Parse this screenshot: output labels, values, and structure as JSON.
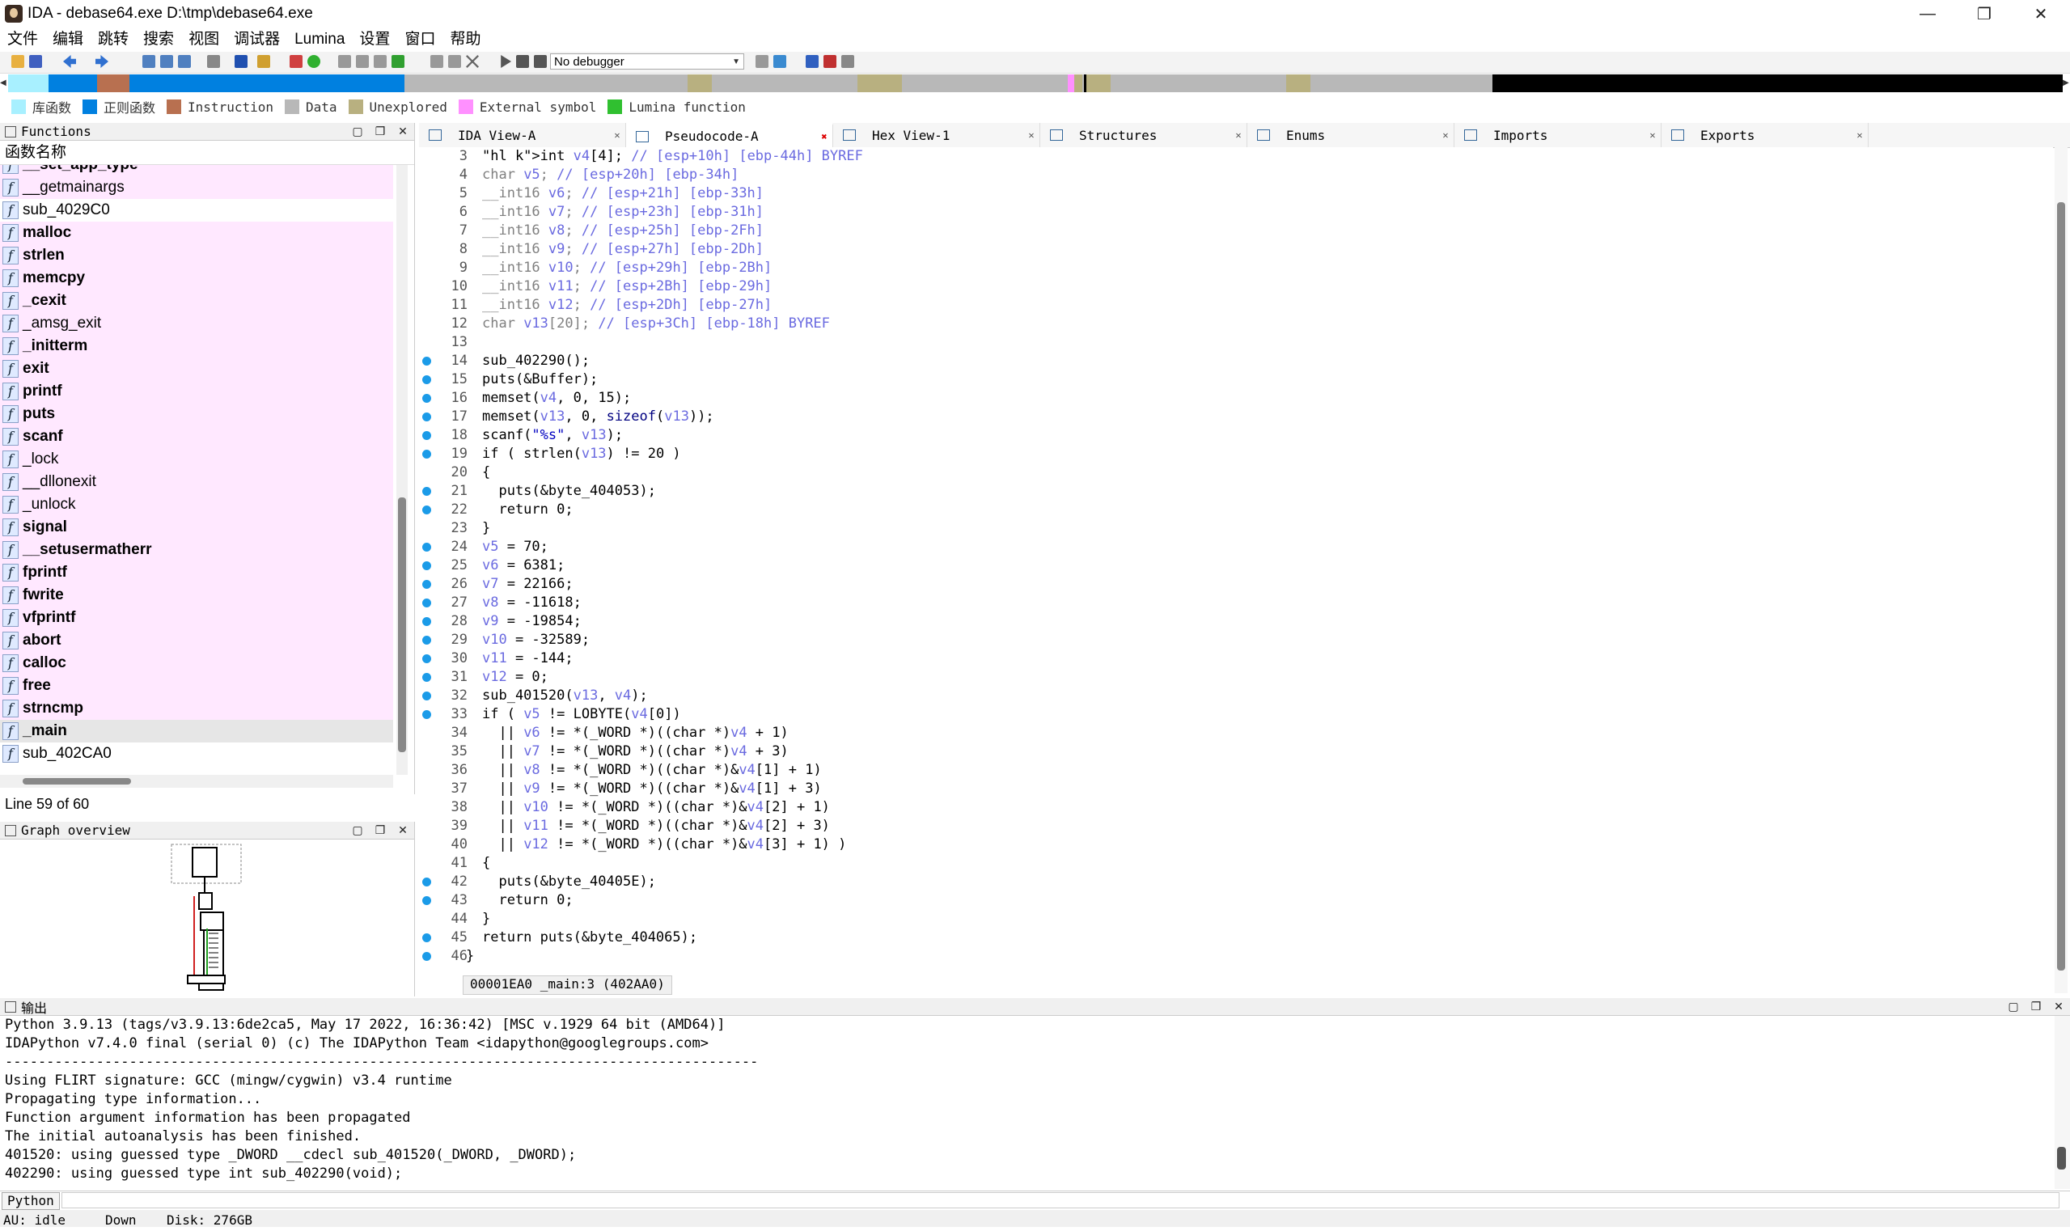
{
  "window": {
    "title": "IDA - debase64.exe D:\\tmp\\debase64.exe",
    "minimize": "—",
    "restore": "❐",
    "close": "✕"
  },
  "menu": [
    "文件",
    "编辑",
    "跳转",
    "搜索",
    "视图",
    "调试器",
    "Lumina",
    "设置",
    "窗口",
    "帮助"
  ],
  "toolbar": {
    "debugger_select": "No debugger"
  },
  "legend": [
    {
      "label": "库函数",
      "color": "#a8f0ff"
    },
    {
      "label": "正则函数",
      "color": "#0080e0"
    },
    {
      "label": "Instruction",
      "color": "#b87050"
    },
    {
      "label": "Data",
      "color": "#b8b8b8"
    },
    {
      "label": "Unexplored",
      "color": "#b8b080"
    },
    {
      "label": "External symbol",
      "color": "#ff90ff"
    },
    {
      "label": "Lumina function",
      "color": "#30c030"
    }
  ],
  "functions_panel": {
    "title": "Functions",
    "column_header": "函数名称",
    "status": "Line 59 of 60",
    "items": [
      {
        "name": "__set_app_type",
        "bold": true,
        "lib": true
      },
      {
        "name": "__getmainargs",
        "bold": false,
        "lib": true
      },
      {
        "name": "sub_4029C0",
        "bold": false,
        "lib": false
      },
      {
        "name": "malloc",
        "bold": true,
        "lib": true
      },
      {
        "name": "strlen",
        "bold": true,
        "lib": true
      },
      {
        "name": "memcpy",
        "bold": true,
        "lib": true
      },
      {
        "name": "_cexit",
        "bold": true,
        "lib": true
      },
      {
        "name": "_amsg_exit",
        "bold": false,
        "lib": true
      },
      {
        "name": "_initterm",
        "bold": true,
        "lib": true
      },
      {
        "name": "exit",
        "bold": true,
        "lib": true
      },
      {
        "name": "printf",
        "bold": true,
        "lib": true
      },
      {
        "name": "puts",
        "bold": true,
        "lib": true
      },
      {
        "name": "scanf",
        "bold": true,
        "lib": true
      },
      {
        "name": "_lock",
        "bold": false,
        "lib": true
      },
      {
        "name": "__dllonexit",
        "bold": false,
        "lib": true
      },
      {
        "name": "_unlock",
        "bold": false,
        "lib": true
      },
      {
        "name": "signal",
        "bold": true,
        "lib": true
      },
      {
        "name": "__setusermatherr",
        "bold": true,
        "lib": true
      },
      {
        "name": "fprintf",
        "bold": true,
        "lib": true
      },
      {
        "name": "fwrite",
        "bold": true,
        "lib": true
      },
      {
        "name": "vfprintf",
        "bold": true,
        "lib": true
      },
      {
        "name": "abort",
        "bold": true,
        "lib": true
      },
      {
        "name": "calloc",
        "bold": true,
        "lib": true
      },
      {
        "name": "free",
        "bold": true,
        "lib": true
      },
      {
        "name": "strncmp",
        "bold": true,
        "lib": true
      },
      {
        "name": "_main",
        "bold": true,
        "lib": false,
        "selected": true
      },
      {
        "name": "sub_402CA0",
        "bold": false,
        "lib": false
      }
    ]
  },
  "graph_panel": {
    "title": "Graph overview"
  },
  "tabs": [
    {
      "label": "IDA View-A",
      "active": false
    },
    {
      "label": "Pseudocode-A",
      "active": true
    },
    {
      "label": "Hex View-1",
      "active": false
    },
    {
      "label": "Structures",
      "active": false
    },
    {
      "label": "Enums",
      "active": false
    },
    {
      "label": "Imports",
      "active": false
    },
    {
      "label": "Exports",
      "active": false
    }
  ],
  "code": {
    "status": "00001EA0 _main:3 (402AA0)",
    "lines": [
      {
        "n": "3",
        "dot": false,
        "t": "int v4[4]; // [esp+10h] [ebp-44h] BYREF"
      },
      {
        "n": "4",
        "dot": false,
        "t": "char v5; // [esp+20h] [ebp-34h]"
      },
      {
        "n": "5",
        "dot": false,
        "t": "__int16 v6; // [esp+21h] [ebp-33h]"
      },
      {
        "n": "6",
        "dot": false,
        "t": "__int16 v7; // [esp+23h] [ebp-31h]"
      },
      {
        "n": "7",
        "dot": false,
        "t": "__int16 v8; // [esp+25h] [ebp-2Fh]"
      },
      {
        "n": "8",
        "dot": false,
        "t": "__int16 v9; // [esp+27h] [ebp-2Dh]"
      },
      {
        "n": "9",
        "dot": false,
        "t": "__int16 v10; // [esp+29h] [ebp-2Bh]"
      },
      {
        "n": "10",
        "dot": false,
        "t": "__int16 v11; // [esp+2Bh] [ebp-29h]"
      },
      {
        "n": "11",
        "dot": false,
        "t": "__int16 v12; // [esp+2Dh] [ebp-27h]"
      },
      {
        "n": "12",
        "dot": false,
        "t": "char v13[20]; // [esp+3Ch] [ebp-18h] BYREF"
      },
      {
        "n": "13",
        "dot": false,
        "t": ""
      },
      {
        "n": "14",
        "dot": true,
        "t": "sub_402290();"
      },
      {
        "n": "15",
        "dot": true,
        "t": "puts(&Buffer);"
      },
      {
        "n": "16",
        "dot": true,
        "t": "memset(v4, 0, 15);"
      },
      {
        "n": "17",
        "dot": true,
        "t": "memset(v13, 0, sizeof(v13));"
      },
      {
        "n": "18",
        "dot": true,
        "t": "scanf(\"%s\", v13);"
      },
      {
        "n": "19",
        "dot": true,
        "t": "if ( strlen(v13) != 20 )"
      },
      {
        "n": "20",
        "dot": false,
        "t": "{"
      },
      {
        "n": "21",
        "dot": true,
        "t": "  puts(&byte_404053);"
      },
      {
        "n": "22",
        "dot": true,
        "t": "  return 0;"
      },
      {
        "n": "23",
        "dot": false,
        "t": "}"
      },
      {
        "n": "24",
        "dot": true,
        "t": "v5 = 70;"
      },
      {
        "n": "25",
        "dot": true,
        "t": "v6 = 6381;"
      },
      {
        "n": "26",
        "dot": true,
        "t": "v7 = 22166;"
      },
      {
        "n": "27",
        "dot": true,
        "t": "v8 = -11618;"
      },
      {
        "n": "28",
        "dot": true,
        "t": "v9 = -19854;"
      },
      {
        "n": "29",
        "dot": true,
        "t": "v10 = -32589;"
      },
      {
        "n": "30",
        "dot": true,
        "t": "v11 = -144;"
      },
      {
        "n": "31",
        "dot": true,
        "t": "v12 = 0;"
      },
      {
        "n": "32",
        "dot": true,
        "t": "sub_401520(v13, v4);"
      },
      {
        "n": "33",
        "dot": true,
        "t": "if ( v5 != LOBYTE(v4[0])"
      },
      {
        "n": "34",
        "dot": false,
        "t": "  || v6 != *(_WORD *)((char *)v4 + 1)"
      },
      {
        "n": "35",
        "dot": false,
        "t": "  || v7 != *(_WORD *)((char *)v4 + 3)"
      },
      {
        "n": "36",
        "dot": false,
        "t": "  || v8 != *(_WORD *)((char *)&v4[1] + 1)"
      },
      {
        "n": "37",
        "dot": false,
        "t": "  || v9 != *(_WORD *)((char *)&v4[1] + 3)"
      },
      {
        "n": "38",
        "dot": false,
        "t": "  || v10 != *(_WORD *)((char *)&v4[2] + 1)"
      },
      {
        "n": "39",
        "dot": false,
        "t": "  || v11 != *(_WORD *)((char *)&v4[2] + 3)"
      },
      {
        "n": "40",
        "dot": false,
        "t": "  || v12 != *(_WORD *)((char *)&v4[3] + 1) )"
      },
      {
        "n": "41",
        "dot": false,
        "t": "{"
      },
      {
        "n": "42",
        "dot": true,
        "t": "  puts(&byte_40405E);"
      },
      {
        "n": "43",
        "dot": true,
        "t": "  return 0;"
      },
      {
        "n": "44",
        "dot": false,
        "t": "}"
      },
      {
        "n": "45",
        "dot": true,
        "t": "return puts(&byte_404065);"
      },
      {
        "n": "46",
        "dot": true,
        "t": "}"
      }
    ]
  },
  "output": {
    "title": "输出",
    "lines": [
      "Python 3.9.13 (tags/v3.9.13:6de2ca5, May 17 2022, 16:36:42) [MSC v.1929 64 bit (AMD64)]",
      "IDAPython v7.4.0 final (serial 0) (c) The IDAPython Team <idapython@googlegroups.com>",
      "-------------------------------------------------------------------------------------------",
      "Using FLIRT signature: GCC (mingw/cygwin) v3.4 runtime",
      "Propagating type information...",
      "Function argument information has been propagated",
      "The initial autoanalysis has been finished.",
      "401520: using guessed type _DWORD __cdecl sub_401520(_DWORD, _DWORD);",
      "402290: using guessed type int sub_402290(void);"
    ]
  },
  "cmdline": {
    "lang": "Python"
  },
  "statusbar": {
    "au": "AU:  idle",
    "dir": "Down",
    "disk": "Disk: 276GB"
  }
}
